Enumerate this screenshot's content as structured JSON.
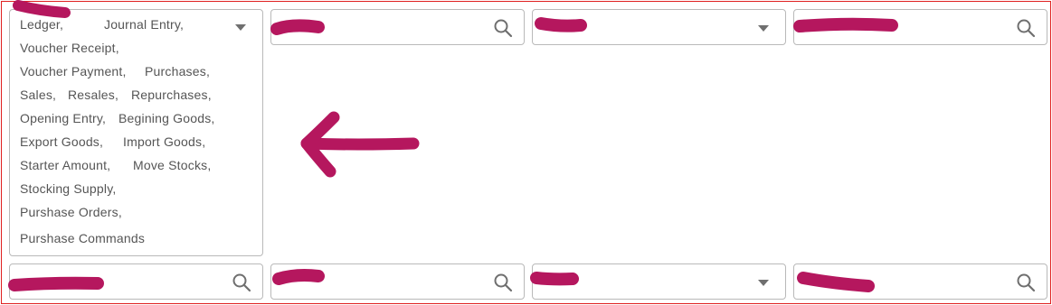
{
  "theme": {
    "frame_border": "#e02020",
    "field_border": "#b9b9b9",
    "icon_color": "#6f6f6f",
    "text_color": "#555555",
    "annotation_color": "#b5175e"
  },
  "icons": {
    "search": "search-icon",
    "dropdown": "caret-down-icon"
  },
  "type_selector": {
    "selected_items": [
      "Ledger,",
      "Journal Entry,",
      "Voucher Receipt,",
      "Voucher Payment,",
      "Purchases,",
      "Sales,",
      "Resales,",
      "Repurchases,",
      "Opening Entry,",
      "Begining Goods,",
      "Export Goods,",
      "Import Goods,",
      "Starter Amount,",
      "Move Stocks,",
      "Stocking Supply,",
      "Purshase Orders,",
      "Purshase Commands"
    ]
  }
}
